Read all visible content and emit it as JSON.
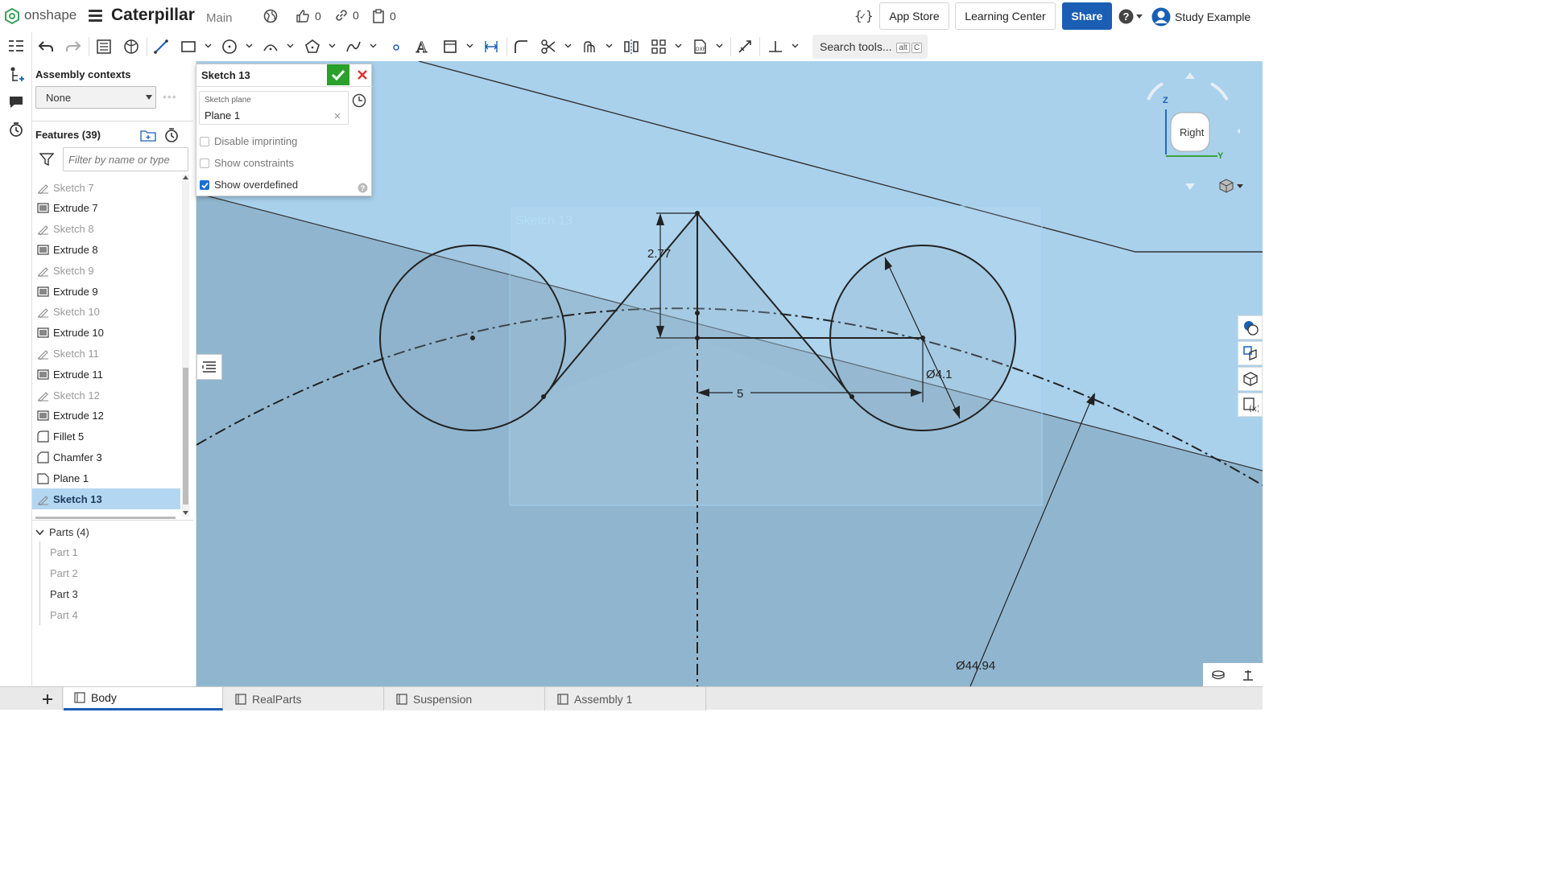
{
  "app": {
    "logo_text": "onshape",
    "doc_title": "Caterpillar",
    "branch": "Main",
    "likes": "0",
    "links": "0",
    "copies": "0"
  },
  "topbar": {
    "app_store": "App Store",
    "learning_center": "Learning Center",
    "share": "Share",
    "user": "Study Example"
  },
  "toolbar": {
    "search_label": "Search tools...",
    "search_kbd1": "alt",
    "search_kbd2": "C"
  },
  "assembly_contexts": {
    "label": "Assembly contexts",
    "value": "None"
  },
  "features": {
    "title": "Features (39)",
    "filter_placeholder": "Filter by name or type",
    "items": [
      {
        "label": "Sketch 7",
        "kind": "sketch"
      },
      {
        "label": "Extrude 7",
        "kind": "extrude"
      },
      {
        "label": "Sketch 8",
        "kind": "sketch"
      },
      {
        "label": "Extrude 8",
        "kind": "extrude"
      },
      {
        "label": "Sketch 9",
        "kind": "sketch"
      },
      {
        "label": "Extrude 9",
        "kind": "extrude"
      },
      {
        "label": "Sketch 10",
        "kind": "sketch"
      },
      {
        "label": "Extrude 10",
        "kind": "extrude"
      },
      {
        "label": "Sketch 11",
        "kind": "sketch"
      },
      {
        "label": "Extrude 11",
        "kind": "extrude"
      },
      {
        "label": "Sketch 12",
        "kind": "sketch"
      },
      {
        "label": "Extrude 12",
        "kind": "extrude"
      },
      {
        "label": "Fillet 5",
        "kind": "fillet"
      },
      {
        "label": "Chamfer 3",
        "kind": "chamfer"
      },
      {
        "label": "Plane 1",
        "kind": "plane"
      },
      {
        "label": "Sketch 13",
        "kind": "sketch",
        "selected": true
      }
    ]
  },
  "parts": {
    "title": "Parts (4)",
    "items": [
      "Part 1",
      "Part 2",
      "Part 3",
      "Part 4"
    ]
  },
  "sketch_dialog": {
    "title": "Sketch 13",
    "plane_label": "Sketch plane",
    "plane_value": "Plane 1",
    "disable_imprinting": "Disable imprinting",
    "show_constraints": "Show constraints",
    "show_overdefined": "Show overdefined",
    "show_overdefined_checked": true
  },
  "viewport": {
    "sketch_name": "Sketch 13",
    "dim_height": "2.77",
    "dim_width": "5",
    "dim_small_dia": "Ø4.1",
    "dim_large_dia": "Ø44.94",
    "view_cube_label": "Right",
    "axis_z": "Z",
    "axis_y": "Y"
  },
  "tabs": [
    {
      "label": "Body",
      "active": true
    },
    {
      "label": "RealParts"
    },
    {
      "label": "Suspension"
    },
    {
      "label": "Assembly 1"
    }
  ],
  "colors": {
    "viewport_bg": "#a9d1ec",
    "accent": "#1a5fb4",
    "selected_row": "#b3d7f2",
    "confirm": "#2aa12a"
  }
}
